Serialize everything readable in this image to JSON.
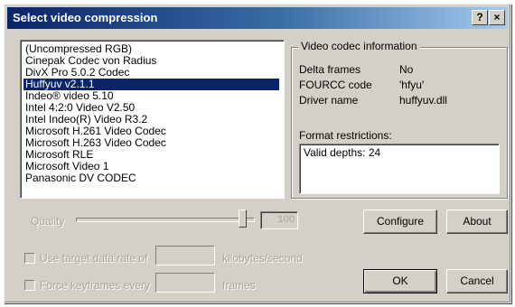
{
  "window": {
    "title": "Select video compression",
    "help_glyph": "?",
    "close_glyph": "×"
  },
  "codecs": {
    "items": [
      "(Uncompressed RGB)",
      "Cinepak Codec von Radius",
      "DivX Pro 5.0.2 Codec",
      "Huffyuv v2.1.1",
      "Indeo® video 5.10",
      "Intel 4:2:0 Video V2.50",
      "Intel Indeo(R) Video R3.2",
      "Microsoft H.261 Video Codec",
      "Microsoft H.263 Video Codec",
      "Microsoft RLE",
      "Microsoft Video 1",
      "Panasonic DV CODEC"
    ],
    "selected": "Huffyuv v2.1.1"
  },
  "info": {
    "group_title": "Video codec information",
    "delta_label": "Delta frames",
    "delta_value": "No",
    "fourcc_label": "FOURCC code",
    "fourcc_value": "'hfyu'",
    "driver_label": "Driver name",
    "driver_value": "huffyuv.dll",
    "restrictions_label": "Format restrictions:",
    "restrictions_text": "Valid depths: 24"
  },
  "quality": {
    "label": "Quality",
    "value": "100",
    "level": 1.0
  },
  "target_rate": {
    "label": "Use target data rate of",
    "value": "",
    "unit": "kilobytes/second",
    "checked": false
  },
  "keyframes": {
    "label": "Force keyframes every",
    "value": "",
    "unit": "frames",
    "checked": false
  },
  "buttons": {
    "configure": "Configure",
    "about": "About",
    "ok": "OK",
    "cancel": "Cancel"
  }
}
